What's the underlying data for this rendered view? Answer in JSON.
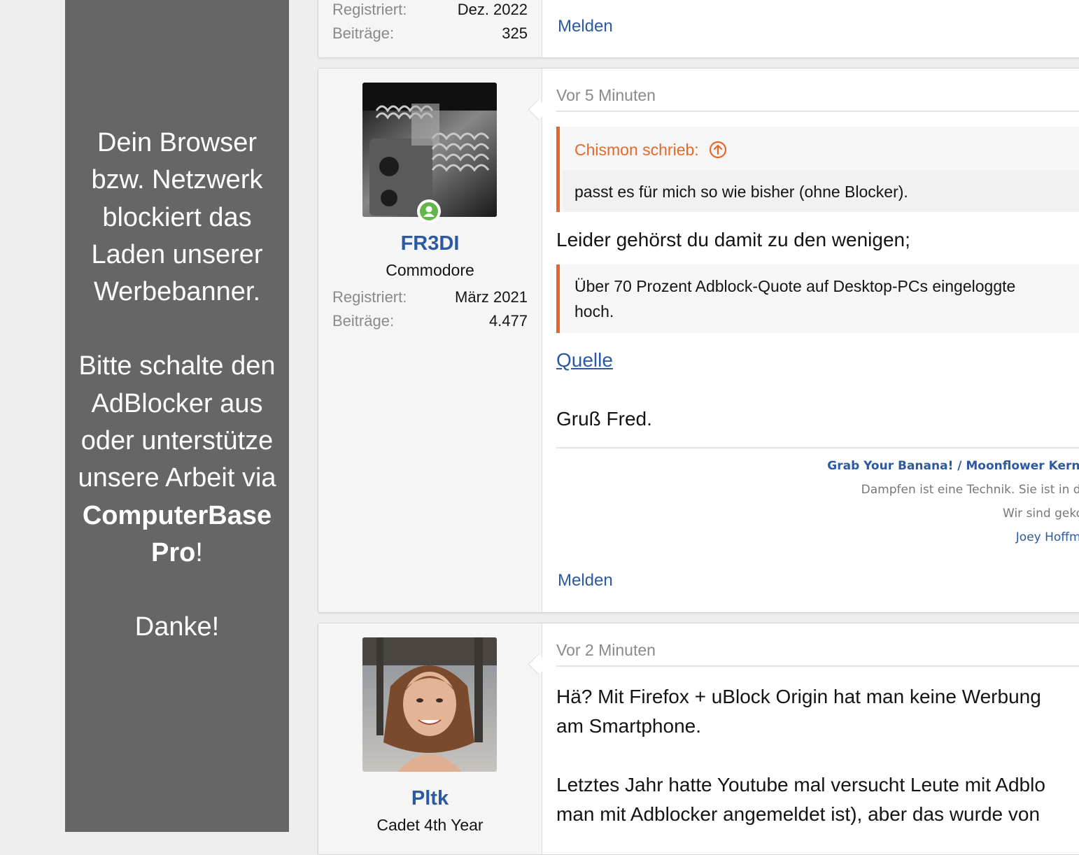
{
  "ad_panel": {
    "line1": "Dein Browser bzw. Netzwerk blockiert das Laden unserer Werbebanner.",
    "line2_prefix": "Bitte schalte den AdBlocker aus oder unterstütze unsere Arbeit via ",
    "line2_brand": "ComputerBase Pro",
    "line2_suffix": "!",
    "line3": "Danke!"
  },
  "post_prev": {
    "stats": [
      {
        "label": "Registriert:",
        "value": "Dez. 2022"
      },
      {
        "label": "Beiträge:",
        "value": "325"
      }
    ],
    "report_label": "Melden"
  },
  "post_fr3di": {
    "username": "FR3DI",
    "user_title": "Commodore",
    "stats": [
      {
        "label": "Registriert:",
        "value": "März 2021"
      },
      {
        "label": "Beiträge:",
        "value": "4.477"
      }
    ],
    "time": "Vor 5 Minuten",
    "quote1": {
      "author": "Chismon schrieb:",
      "text": "passt es für mich so wie bisher (ohne Blocker)."
    },
    "text1": "Leider gehörst du damit zu den wenigen;",
    "quote2": {
      "line1": "Über 70 Prozent Adblock-Quote auf Desktop-PCs eingeloggte",
      "line2": "hoch."
    },
    "source_link": "Quelle",
    "greeting": "Gruß Fred.",
    "signature": {
      "line1": "Grab Your Banana! / Moonflower Kerne",
      "line2": "Dampfen ist eine Technik. Sie ist in de",
      "line3": "Wir sind gekor",
      "line4": "Joey Hoffma"
    },
    "report_label": "Melden"
  },
  "post_pltk": {
    "username": "Pltk",
    "user_title": "Cadet 4th Year",
    "time": "Vor 2 Minuten",
    "paragraph1": {
      "line1": "Hä? Mit Firefox + uBlock Origin hat man keine Werbung",
      "line2": "am Smartphone."
    },
    "paragraph2": {
      "line1": "Letztes Jahr hatte Youtube mal versucht Leute mit Adblo",
      "line2": "man mit Adblocker angemeldet ist), aber das wurde von"
    }
  }
}
